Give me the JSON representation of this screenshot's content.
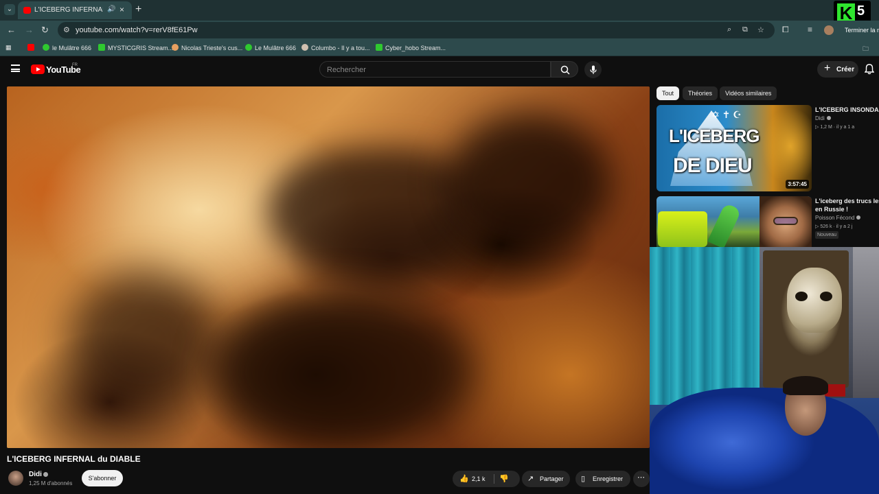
{
  "browser": {
    "tab_title": "L'ICEBERG INFERNAL du DI",
    "url": "youtube.com/watch?v=rerV8fE61Pw",
    "finish_label": "Terminer la m",
    "bookmarks": [
      {
        "label": "le Mulâtre 666",
        "color": "#2fc92f"
      },
      {
        "label": "MYSTICGRIS Stream...",
        "color": "#2fc92f"
      },
      {
        "label": "Nicolas Trieste's cus...",
        "color": "#e8a060"
      },
      {
        "label": "Le Mulâtre 666",
        "color": "#2fc92f"
      },
      {
        "label": "Columbo - Il y a tou...",
        "color": "#d0c0b0"
      },
      {
        "label": "Cyber_hobo Stream...",
        "color": "#2fc92f"
      }
    ],
    "overlay_badge_number": "5"
  },
  "youtube": {
    "logo_text": "YouTube",
    "country": "FR",
    "search_placeholder": "Rechercher",
    "create_label": "Créer"
  },
  "video": {
    "title": "L'ICEBERG INFERNAL du DIABLE",
    "channel": "Didi",
    "subscribers": "1,25 M d'abonnés",
    "subscribe_label": "S'abonner",
    "likes": "2,1 k",
    "share_label": "Partager",
    "save_label": "Enregistrer"
  },
  "sidebar": {
    "chips": [
      "Tout",
      "Théories",
      "Vidéos similaires"
    ],
    "recommendations": [
      {
        "title": "L'ICEBERG INSONDABL",
        "channel": "Didi",
        "meta": "1,2 M · il y a 1 a",
        "duration": "3:57:45",
        "thumb_line1": "L'ICEBERG",
        "thumb_line2": "DE DIEU"
      },
      {
        "title_line1": "L'iceberg des trucs les p",
        "title_line2": "en Russie !",
        "channel": "Poisson Fécond",
        "meta": "526 k · il y a 2 j",
        "badge": "Nouveau"
      }
    ]
  }
}
